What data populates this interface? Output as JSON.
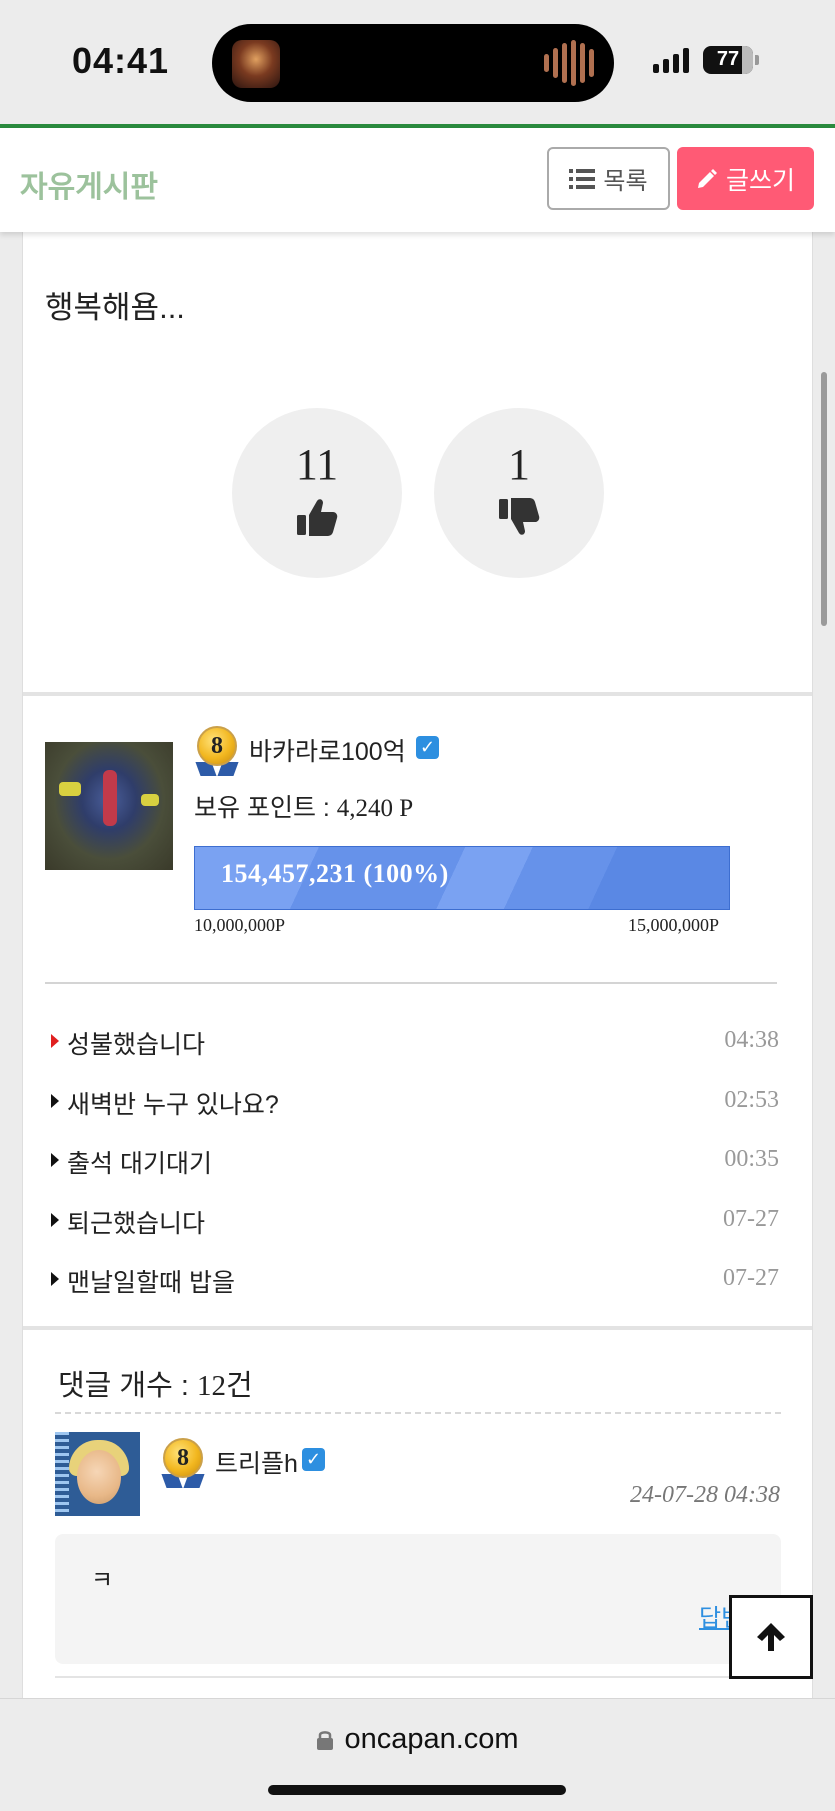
{
  "status_bar": {
    "time": "04:41",
    "battery": "77",
    "icons": [
      "now-playing-thumbnail",
      "audio-wave-icon",
      "signal-icon",
      "battery-icon"
    ]
  },
  "header": {
    "title": "자유게시판",
    "list_button": "목록",
    "write_button": "글쓰기",
    "accent_color": "#ff5a75",
    "title_color": "#9cc29c"
  },
  "post": {
    "body": "행복해욤...",
    "likes": "11",
    "dislikes": "1"
  },
  "author": {
    "level": "8",
    "nickname": "바카라로100억",
    "points_label": "보유 포인트 : ",
    "points_value": "4,240 P",
    "progress_text": "154,457,231 (100%)",
    "progress_percent": 100,
    "range_min": "10,000,000P",
    "range_max": "15,000,000P"
  },
  "recent_posts": [
    {
      "title": "성불했습니다",
      "time": "04:38",
      "highlight": true
    },
    {
      "title": "새벽반 누구 있나요?",
      "time": "02:53",
      "highlight": false
    },
    {
      "title": "출석 대기대기",
      "time": "00:35",
      "highlight": false
    },
    {
      "title": "퇴근했습니다",
      "time": "07-27",
      "highlight": false
    },
    {
      "title": "맨날일할때 밥을",
      "time": "07-27",
      "highlight": false
    }
  ],
  "comments": {
    "count_label": "댓글 개수 : ",
    "count_value": "12건",
    "items": [
      {
        "level": "8",
        "nickname": "트리플h",
        "date": "24-07-28 04:38",
        "text": "ㅋ",
        "reply_label": "답변"
      }
    ]
  },
  "browser": {
    "url": "oncapan.com"
  }
}
